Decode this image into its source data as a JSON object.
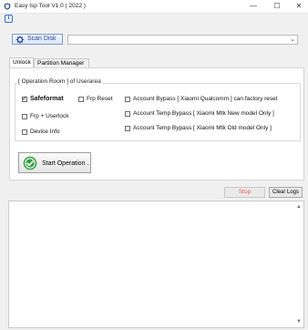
{
  "window": {
    "title": "Easy Isp Tool V1.0 ( 2022 )",
    "minimize": "—",
    "maximize": "☐",
    "close": "✕"
  },
  "toolbar": {
    "info_icon": "i",
    "scan_label": "Scan Disk",
    "disk_value": "",
    "dropdown_icon": "chevron-down-icon"
  },
  "tabs": [
    {
      "label": "Unlock",
      "active": true
    },
    {
      "label": "Partition Manager",
      "active": false
    }
  ],
  "group": {
    "title": "[ Operation Room ] of Userarea"
  },
  "options": {
    "safeformat": {
      "label": "Safeformat",
      "checked": true
    },
    "frp_reset": {
      "label": "Frp Reset",
      "checked": false
    },
    "frp_userlock": {
      "label": "Frp + Userlock",
      "checked": false
    },
    "device_info": {
      "label": "Device Info",
      "checked": false
    },
    "bypass_qualcomm": {
      "label": "Account  Bypass [ Xiaomi Qualcomm ] can factory reset",
      "checked": false
    },
    "temp_bypass_new": {
      "label": "Account Temp Bypass [ Xiaomi Mtk New model Only ]",
      "checked": false
    },
    "temp_bypass_old": {
      "label": "Account Temp Bypass [ Xiaomi Mtk Old model Only ]",
      "checked": false
    }
  },
  "actions": {
    "start_label": "Start Operation .",
    "stop_label": "Stop",
    "clear_label": "Clear Logs"
  },
  "log": {
    "content": "",
    "scroll_up": "▲",
    "scroll_down": "▼"
  },
  "colors": {
    "accent": "#3a70c4",
    "stop_text": "#e05a5a",
    "start_icon": "#2e9e3f"
  }
}
